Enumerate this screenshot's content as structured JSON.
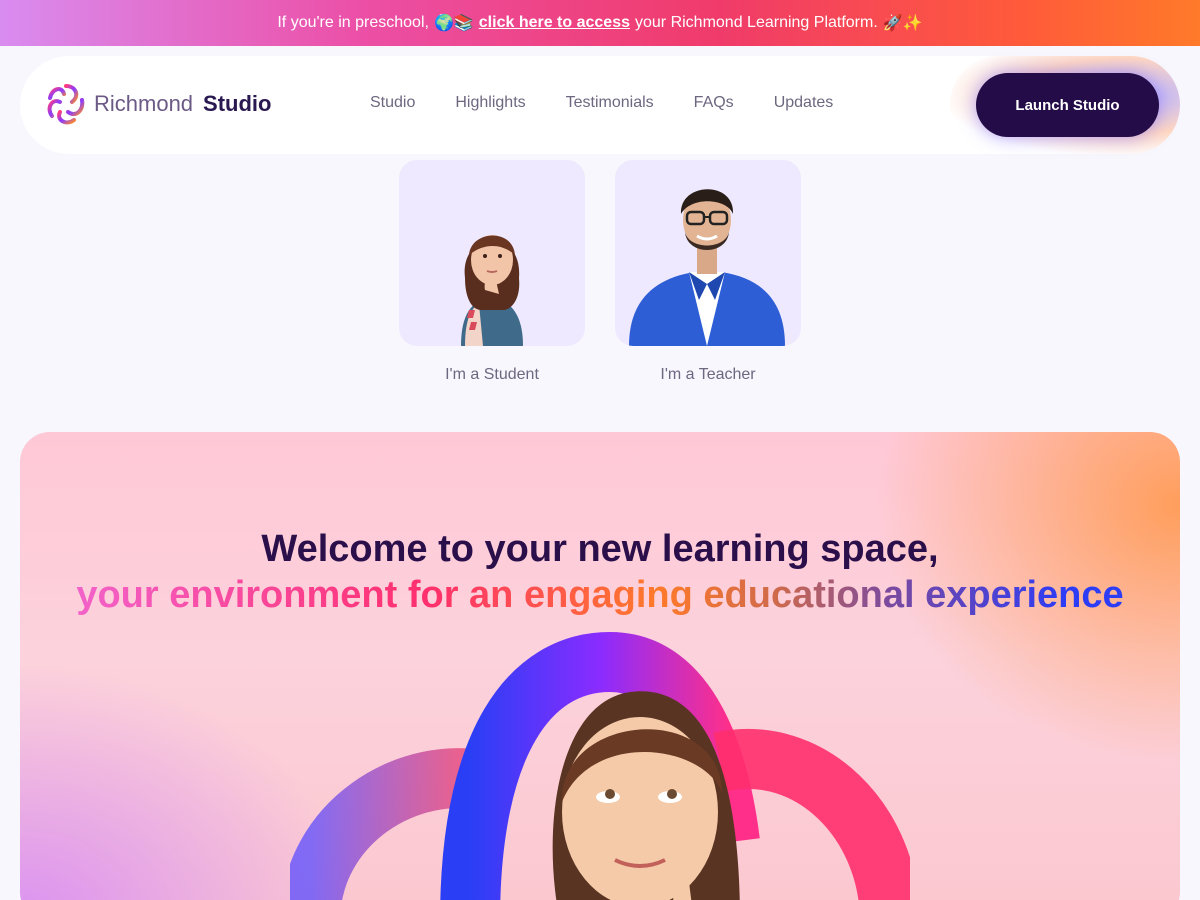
{
  "announcement": {
    "prefix": "If you're in preschool,",
    "emoji_left": "🌍📚",
    "link": "click here to access",
    "suffix": "your Richmond Learning Platform.",
    "emoji_right": "🚀✨"
  },
  "header": {
    "brand_light": "Richmond",
    "brand_bold": "Studio",
    "nav": [
      "Studio",
      "Highlights",
      "Testimonials",
      "FAQs",
      "Updates"
    ],
    "cta": "Launch Studio"
  },
  "roles": [
    {
      "label": "I'm a Student",
      "icon": "student-photo"
    },
    {
      "label": "I'm a Teacher",
      "icon": "teacher-photo"
    }
  ],
  "hero": {
    "title": "Welcome to your new learning space,",
    "subtitle": "your environment for an engaging educational experience"
  },
  "colors": {
    "brand_dark": "#230c47",
    "card_bg": "#eee9fe",
    "page_bg": "#f8f7fd"
  }
}
